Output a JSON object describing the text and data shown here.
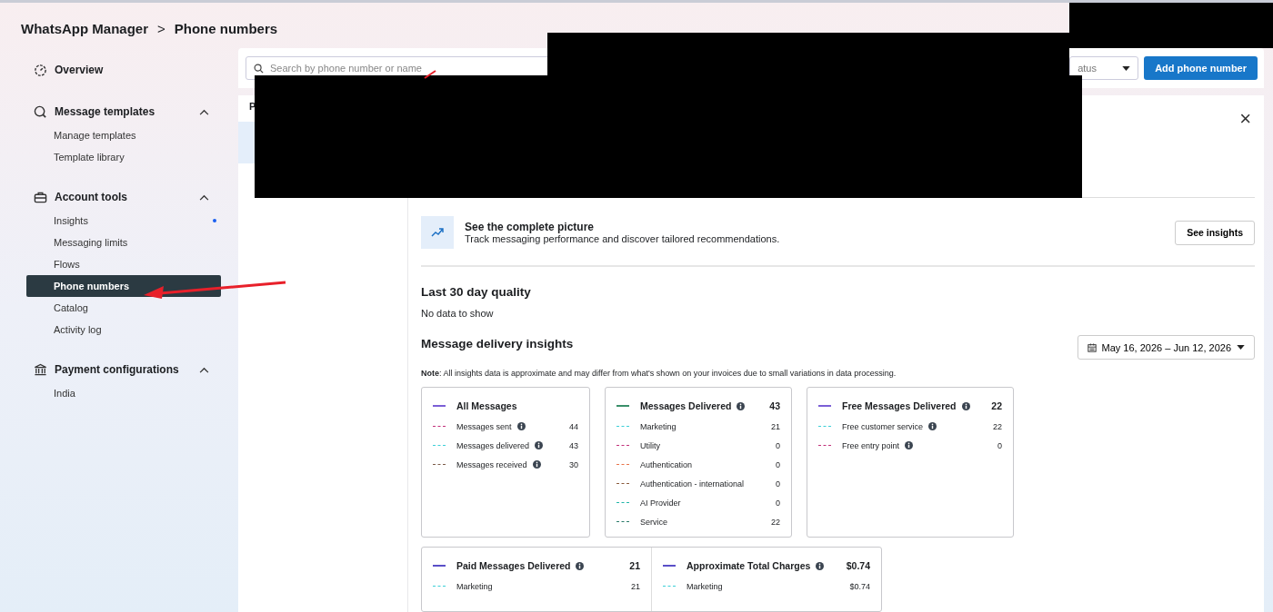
{
  "breadcrumb": {
    "root": "WhatsApp Manager",
    "separator": ">",
    "current": "Phone numbers"
  },
  "sidebar": {
    "sections": [
      {
        "kind": "link",
        "label": "Overview"
      },
      {
        "kind": "group",
        "label": "Message templates",
        "expanded": true,
        "children": [
          {
            "label": "Manage templates",
            "selected": false,
            "dot": false
          },
          {
            "label": "Template library",
            "selected": false,
            "dot": false
          }
        ]
      },
      {
        "kind": "group",
        "label": "Account tools",
        "expanded": true,
        "children": [
          {
            "label": "Insights",
            "selected": false,
            "dot": true
          },
          {
            "label": "Messaging limits",
            "selected": false,
            "dot": false
          },
          {
            "label": "Flows",
            "selected": false,
            "dot": false
          },
          {
            "label": "Phone numbers",
            "selected": true,
            "dot": false
          },
          {
            "label": "Catalog",
            "selected": false,
            "dot": false
          },
          {
            "label": "Activity log",
            "selected": false,
            "dot": false
          }
        ]
      },
      {
        "kind": "group",
        "label": "Payment configurations",
        "expanded": true,
        "children": [
          {
            "label": "India",
            "selected": false,
            "dot": false
          }
        ]
      }
    ]
  },
  "toolbar": {
    "search": {
      "placeholder": "Search by phone number or name"
    },
    "status_filter": {
      "value": "atus"
    },
    "add_button": "Add phone number"
  },
  "list_header": "P",
  "detail": {
    "close": "×",
    "promo": {
      "title": "See the complete picture",
      "text": "Track messaging performance and discover tailored recommendations.",
      "button": "See insights"
    },
    "quality": {
      "title": "Last 30 day quality",
      "text": "No data to show"
    },
    "delivery": {
      "title": "Message delivery insights",
      "date_range": "May 16, 2026 – Jun 12, 2026",
      "note": "**Note**: All insights data is approximate and may differ from what's shown on your invoices due to small variations in data processing."
    },
    "cards": [
      {
        "title": "All Messages",
        "color": "#7b5fd6",
        "info": false,
        "rows": [
          {
            "label": "Messages sent",
            "info": true,
            "value": "44",
            "color": "#c2307a"
          },
          {
            "label": "Messages delivered",
            "info": true,
            "value": "43",
            "color": "#3ccfd8"
          },
          {
            "label": "Messages received",
            "info": true,
            "value": "30",
            "color": "#7a5a48"
          }
        ]
      },
      {
        "title": "Messages Delivered",
        "color": "#3a8f6a",
        "info": true,
        "total": "43",
        "rows": [
          {
            "label": "Marketing",
            "info": false,
            "value": "21",
            "color": "#3ccfd8"
          },
          {
            "label": "Utility",
            "info": false,
            "value": "0",
            "color": "#c2307a"
          },
          {
            "label": "Authentication",
            "info": false,
            "value": "0",
            "color": "#e8744a"
          },
          {
            "label": "Authentication - international",
            "info": false,
            "value": "0",
            "color": "#8a5a3c"
          },
          {
            "label": "AI Provider",
            "info": false,
            "value": "0",
            "color": "#1fb5a8"
          },
          {
            "label": "Service",
            "info": false,
            "value": "22",
            "color": "#2a7a6a"
          }
        ]
      },
      {
        "title": "Free Messages Delivered",
        "color": "#7b5fd6",
        "info": true,
        "total": "22",
        "rows": [
          {
            "label": "Free customer service",
            "info": true,
            "value": "22",
            "color": "#3ccfd8"
          },
          {
            "label": "Free entry point",
            "info": true,
            "value": "0",
            "color": "#c2307a"
          }
        ]
      }
    ],
    "cards_second_row": [
      {
        "title": "Paid Messages Delivered",
        "color": "#5a4fc8",
        "info": true,
        "total": "21",
        "rows": [
          {
            "label": "Marketing",
            "info": false,
            "value": "21",
            "color": "#3ccfd8"
          }
        ]
      },
      {
        "title": "Approximate Total Charges",
        "color": "#5a4fc8",
        "info": true,
        "total": "$0.74",
        "rows": [
          {
            "label": "Marketing",
            "info": false,
            "value": "$0.74",
            "color": "#3ccfd8"
          }
        ]
      }
    ]
  }
}
